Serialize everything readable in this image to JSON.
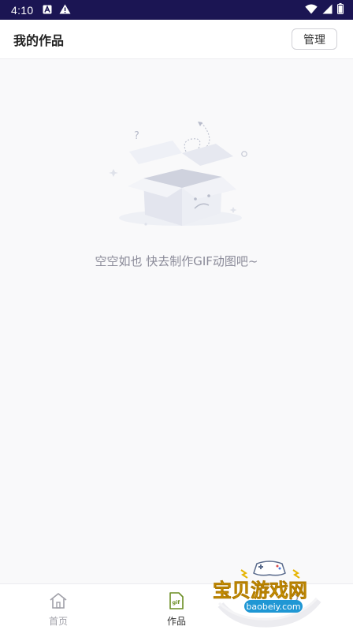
{
  "status_bar": {
    "time": "4:10",
    "left_icons": [
      "notification-a-icon",
      "warning-icon"
    ],
    "right_icons": [
      "wifi-icon",
      "signal-icon",
      "battery-icon"
    ]
  },
  "header": {
    "title": "我的作品",
    "manage_label": "管理"
  },
  "empty_state": {
    "message": "空空如也 快去制作GIF动图吧~",
    "illustration_icon": "empty-box-icon"
  },
  "bottom_nav": {
    "items": [
      {
        "label": "首页",
        "icon": "home-icon",
        "active": false
      },
      {
        "label": "作品",
        "icon": "gif-file-icon",
        "active": true
      },
      {
        "label": "",
        "icon": "user-icon",
        "active": false
      }
    ]
  },
  "watermark": {
    "text": "宝贝游戏网",
    "url": "baobeiy.com"
  },
  "colors": {
    "status_bar": "#1b1553",
    "accent": "#6b8e23",
    "background": "#f9f9fa"
  }
}
